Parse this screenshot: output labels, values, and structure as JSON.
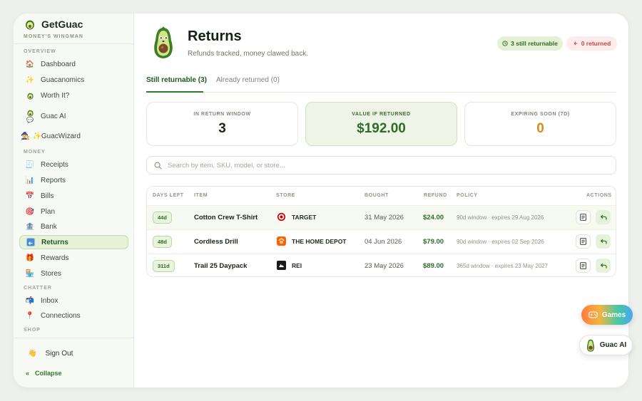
{
  "brand": {
    "name": "GetGuac",
    "tagline": "MONEY'S WINGMAN"
  },
  "sidebar": {
    "sections": {
      "overview": "OVERVIEW",
      "money": "MONEY",
      "chatter": "CHATTER",
      "shop": "SHOP"
    },
    "overview_items": [
      {
        "label": "Dashboard",
        "icon": "house-icon"
      },
      {
        "label": "Guacanomics",
        "icon": "sparkle-icon"
      },
      {
        "label": "Worth It?",
        "icon": "avocado-icon"
      },
      {
        "label": "Guac AI",
        "icon": "avocado-chat-icon"
      }
    ],
    "wizard": "✨GuacWizard",
    "money_items": [
      {
        "label": "Receipts",
        "icon": "receipt-icon"
      },
      {
        "label": "Reports",
        "icon": "bar-chart-icon"
      },
      {
        "label": "Bills",
        "icon": "calendar-icon"
      },
      {
        "label": "Plan",
        "icon": "target-icon"
      },
      {
        "label": "Bank",
        "icon": "bank-icon"
      },
      {
        "label": "Returns",
        "icon": "return-icon",
        "active": true
      },
      {
        "label": "Rewards",
        "icon": "gift-icon"
      },
      {
        "label": "Stores",
        "icon": "store-icon"
      }
    ],
    "chatter_items": [
      {
        "label": "Inbox",
        "icon": "mailbox-icon"
      },
      {
        "label": "Connections",
        "icon": "pin-icon"
      }
    ],
    "signout": "Sign Out",
    "collapse": "Collapse"
  },
  "header": {
    "title": "Returns",
    "subtitle": "Refunds tracked, money clawed back.",
    "pill_returnable": "3 still returnable",
    "pill_returned": "0 returned"
  },
  "tabs": {
    "returnable": "Still returnable (3)",
    "returned": "Already returned (0)"
  },
  "stats": [
    {
      "label": "IN RETURN WINDOW",
      "value": "3"
    },
    {
      "label": "VALUE IF RETURNED",
      "value": "$192.00"
    },
    {
      "label": "EXPIRING SOON (7D)",
      "value": "0"
    }
  ],
  "search": {
    "placeholder": "Search by item, SKU, model, or store..."
  },
  "table": {
    "headers": {
      "days": "DAYS LEFT",
      "item": "ITEM",
      "store": "STORE",
      "bought": "BOUGHT",
      "refund": "REFUND",
      "policy": "POLICY",
      "actions": "ACTIONS"
    },
    "rows": [
      {
        "days": "44d",
        "item": "Cotton Crew T-Shirt",
        "store": "TARGET",
        "bought": "31 May 2026",
        "refund": "$24.00",
        "policy": "90d window · expires 29 Aug 2026"
      },
      {
        "days": "48d",
        "item": "Cordless Drill",
        "store": "THE HOME DEPOT",
        "bought": "04 Jun 2026",
        "refund": "$79.00",
        "policy": "90d window · expires 02 Sep 2026"
      },
      {
        "days": "311d",
        "item": "Trail 25 Daypack",
        "store": "REI",
        "bought": "23 May 2026",
        "refund": "$89.00",
        "policy": "365d window · expires 23 May 2027"
      }
    ]
  },
  "floating": {
    "games": "Games",
    "guac_ai": "Guac AI"
  },
  "colors": {
    "accent": "#2f7a2a",
    "active_bg": "#e6f1da",
    "warning": "#d98a1e",
    "danger": "#c24a43"
  }
}
